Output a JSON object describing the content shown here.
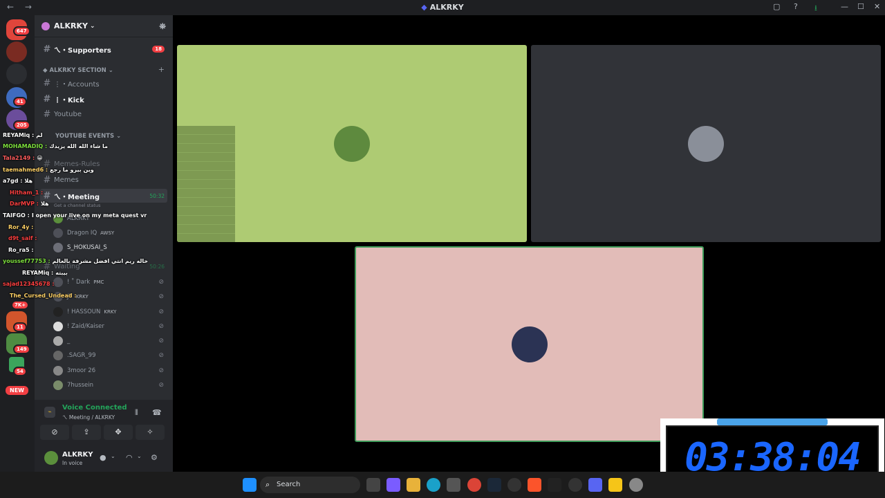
{
  "window": {
    "title": "ALKRKY",
    "nav": "← →"
  },
  "titlebar_controls": [
    "▢",
    "?",
    "⭳",
    "—",
    "☐",
    "✕"
  ],
  "servers": [
    {
      "badge": "647",
      "color": "#e0453b"
    },
    {
      "badge": "",
      "color": "#7a2b22",
      "label": "HEART"
    },
    {
      "badge": "",
      "color": "#2b2d31",
      "label": "CLOUD"
    },
    {
      "badge": "41",
      "color": "#3e6bbf"
    },
    {
      "badge": "205",
      "color": "#6b4d9b"
    },
    {
      "badge": "7K+",
      "color": "#c2462e"
    },
    {
      "badge": "11",
      "color": "#d2552c"
    },
    {
      "badge": "149",
      "color": "#4f8c42"
    },
    {
      "badge": "54",
      "color": "#3ba55c"
    },
    {
      "badge": "NEW",
      "color": "#1e1f22"
    }
  ],
  "guild": {
    "name": "ALKRKY",
    "chevron": "⌄"
  },
  "channels": {
    "supporters": {
      "label": "ㄟ・Supporters",
      "badge": "18"
    },
    "section_label": "ALKRKY SECTION",
    "accounts": "⋮・Accounts",
    "kick": "⋮・Kick",
    "youtube": "Youtube",
    "youtube_events": "YOUTUBE EVENTS",
    "memes_rules": "Memes-Rules",
    "memes": "Memes",
    "meeting": "ㄟ・Meeting",
    "meeting_time": "50:32",
    "channel_status": "Get a channel status",
    "waiting": "Waiting",
    "waiting_time": "50:26"
  },
  "voice_members": [
    {
      "name": "ALKRKY",
      "tag": ""
    },
    {
      "name": "Dragon IQ",
      "tag": "AWSY"
    },
    {
      "name": "S_HOKUSAI_S",
      "tag": ""
    },
    {
      "name": "! ˚ Dark",
      "tag": "PMC"
    },
    {
      "name": "JT",
      "tag": "KRKY"
    },
    {
      "name": "! HASSOUN",
      "tag": "KRKY"
    },
    {
      "name": "! Zaid/Kaiser",
      "tag": ""
    },
    {
      "name": "_",
      "tag": ""
    },
    {
      "name": ".SAGR_99",
      "tag": ""
    },
    {
      "name": "3moor 26",
      "tag": ""
    },
    {
      "name": "7hussein",
      "tag": ""
    }
  ],
  "chat_overlay": [
    {
      "user": "REYAMiq :",
      "text": "لم",
      "color": "#ffffff"
    },
    {
      "user": "MOHAMADIQ :",
      "text": "ما شاء الله الله يزيدك",
      "color": "#7ee03d"
    },
    {
      "user": "Tala2149 :",
      "text": "😀",
      "color": "#ff5b5b"
    },
    {
      "user": "taemahmed6 :",
      "text": "وين بيرو ما رجع",
      "color": "#ffd166"
    },
    {
      "user": "a7gd :",
      "text": "هلا",
      "color": "#ffffff"
    },
    {
      "user": "Hitham_1 :",
      "text": "",
      "color": "#ff4040"
    },
    {
      "user": "DarMVP :",
      "text": "هلا",
      "color": "#ff4040"
    },
    {
      "user": "TAIFGO :",
      "text": "I open your live on my meta quest vr",
      "color": "#ffffff"
    },
    {
      "user": "Ror_4y :",
      "text": "",
      "color": "#ffd166"
    },
    {
      "user": "d9t_saif :",
      "text": "",
      "color": "#ff4040"
    },
    {
      "user": "Ro_ra5 :",
      "text": "",
      "color": "#ffffff"
    },
    {
      "user": "youssef77753 :",
      "text": "خاله ريم انتي افضل مشرفة بالعالم",
      "color": "#7ee03d"
    },
    {
      "user": "REYAMiq :",
      "text": "بيبته",
      "color": "#ffffff"
    },
    {
      "user": "sajad12345678 :",
      "text": "",
      "color": "#ff4040"
    },
    {
      "user": "The_Cursed_Undead :",
      "text": "",
      "color": "#ffd166"
    }
  ],
  "voice": {
    "status": "Voice Connected",
    "channel": "ㄟ Meeting / ALKRKY"
  },
  "user": {
    "name": "ALKRKY",
    "status": "In voice"
  },
  "timer": {
    "value": "03:38:04"
  },
  "taskbar": {
    "search": "Search"
  }
}
